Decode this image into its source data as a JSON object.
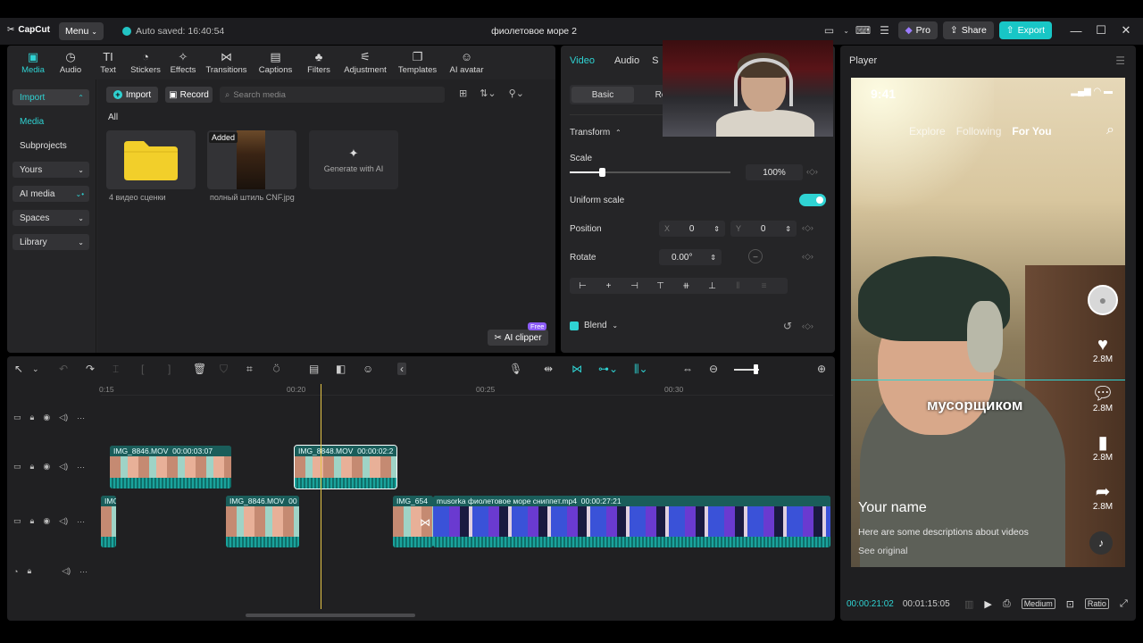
{
  "titlebar": {
    "logo": "CapCut",
    "menu_label": "Menu",
    "autosave": "Auto saved: 16:40:54",
    "project_title": "фиолетовое море 2",
    "pro_label": "Pro",
    "share_label": "Share",
    "export_label": "Export",
    "accent_color": "#18c6c6"
  },
  "tools": [
    {
      "label": "Media",
      "icon": "media-icon",
      "active": true
    },
    {
      "label": "Audio",
      "icon": "audio-icon"
    },
    {
      "label": "Text",
      "icon": "text-icon"
    },
    {
      "label": "Stickers",
      "icon": "stickers-icon"
    },
    {
      "label": "Effects",
      "icon": "effects-icon"
    },
    {
      "label": "Transitions",
      "icon": "transitions-icon"
    },
    {
      "label": "Captions",
      "icon": "captions-icon"
    },
    {
      "label": "Filters",
      "icon": "filters-icon"
    },
    {
      "label": "Adjustment",
      "icon": "adjustment-icon"
    },
    {
      "label": "Templates",
      "icon": "templates-icon"
    },
    {
      "label": "AI avatar",
      "icon": "ai-avatar-icon"
    }
  ],
  "sidebar": {
    "items": [
      {
        "label": "Import"
      },
      {
        "label": "Media"
      },
      {
        "label": "Subprojects"
      },
      {
        "label": "Yours"
      },
      {
        "label": "AI media"
      },
      {
        "label": "Spaces"
      },
      {
        "label": "Library"
      }
    ]
  },
  "media": {
    "import_label": "Import",
    "record_label": "Record",
    "search_placeholder": "Search media",
    "all_label": "All",
    "items": [
      {
        "label": "4 видео сценки",
        "type": "folder"
      },
      {
        "label": "полный штиль CNF.jpg",
        "badge": "Added"
      }
    ],
    "generate_label": "Generate with AI",
    "ai_clipper_label": "AI clipper",
    "free_badge": "Free"
  },
  "props": {
    "tabs": [
      "Video",
      "Audio",
      "S"
    ],
    "subtabs": [
      "Basic",
      "Remo"
    ],
    "transform_label": "Transform",
    "scale_label": "Scale",
    "scale_value": "100%",
    "scale_level": 0.2,
    "uniform_scale_label": "Uniform scale",
    "uniform_scale_on": true,
    "position_label": "Position",
    "pos_x_label": "X",
    "pos_x": "0",
    "pos_y_label": "Y",
    "pos_y": "0",
    "rotate_label": "Rotate",
    "rotate_value": "0.00°",
    "blend_label": "Blend"
  },
  "player": {
    "title": "Player",
    "status_time": "9:41",
    "feed_tabs": [
      "Explore",
      "Following",
      "For You"
    ],
    "caption": "мусорщиком",
    "likes": "2.8M",
    "comments": "2.8M",
    "saves": "2.8M",
    "shares": "2.8M",
    "your_name": "Your name",
    "description": "Here are some descriptions about videos",
    "see_original": "See original",
    "current_time": "00:00:21:02",
    "duration": "00:01:15:05",
    "quality": "Medium",
    "ratio": "Ratio"
  },
  "timeline": {
    "ruler_labels": [
      "0:15",
      "00:20",
      "00:25",
      "00:30"
    ],
    "clips_track2": [
      {
        "name": "IMG_8846.MOV",
        "duration": "00:00:03:07"
      },
      {
        "name": "IMG_8848.MOV",
        "duration": "00:00:02:2"
      }
    ],
    "clips_track3": [
      {
        "name": "IMG_8",
        "duration": ""
      },
      {
        "name": "IMG_8846.MOV",
        "duration": "00"
      },
      {
        "name": "IMG_654",
        "duration": ""
      },
      {
        "name": "musorka фиолетовое море сниппет.mp4",
        "duration": "00:00:27:21"
      }
    ]
  }
}
